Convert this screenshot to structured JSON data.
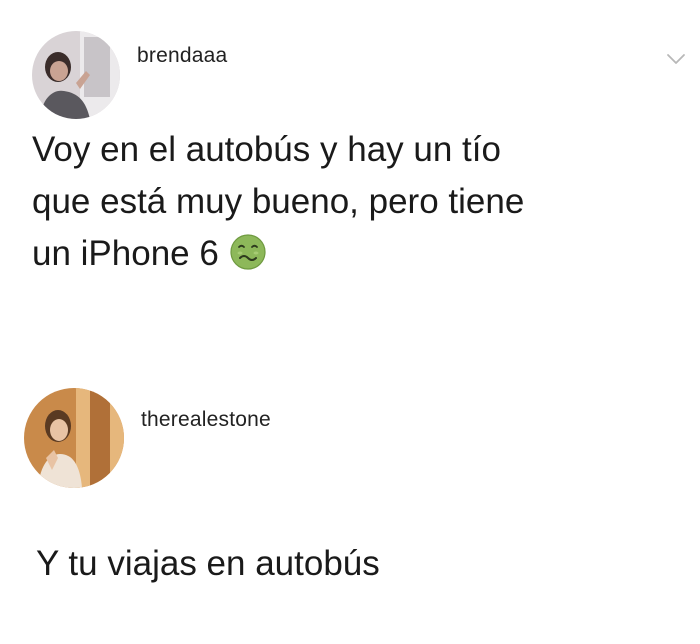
{
  "posts": [
    {
      "username": "brendaaa",
      "text_lines": [
        "Voy en el autobús y hay un tío",
        "que está muy bueno, pero tiene",
        "un iPhone 6"
      ],
      "emoji": "nauseated-face-icon"
    },
    {
      "username": "therealestone",
      "text_lines": [
        "Y tu viajas en autobús"
      ]
    }
  ],
  "icons": {
    "menu": "chevron-down-icon"
  },
  "colors": {
    "background": "#ffffff",
    "text": "#1a1a1a",
    "chevron": "#b8b8b8",
    "emoji_green": "#8db85a"
  }
}
